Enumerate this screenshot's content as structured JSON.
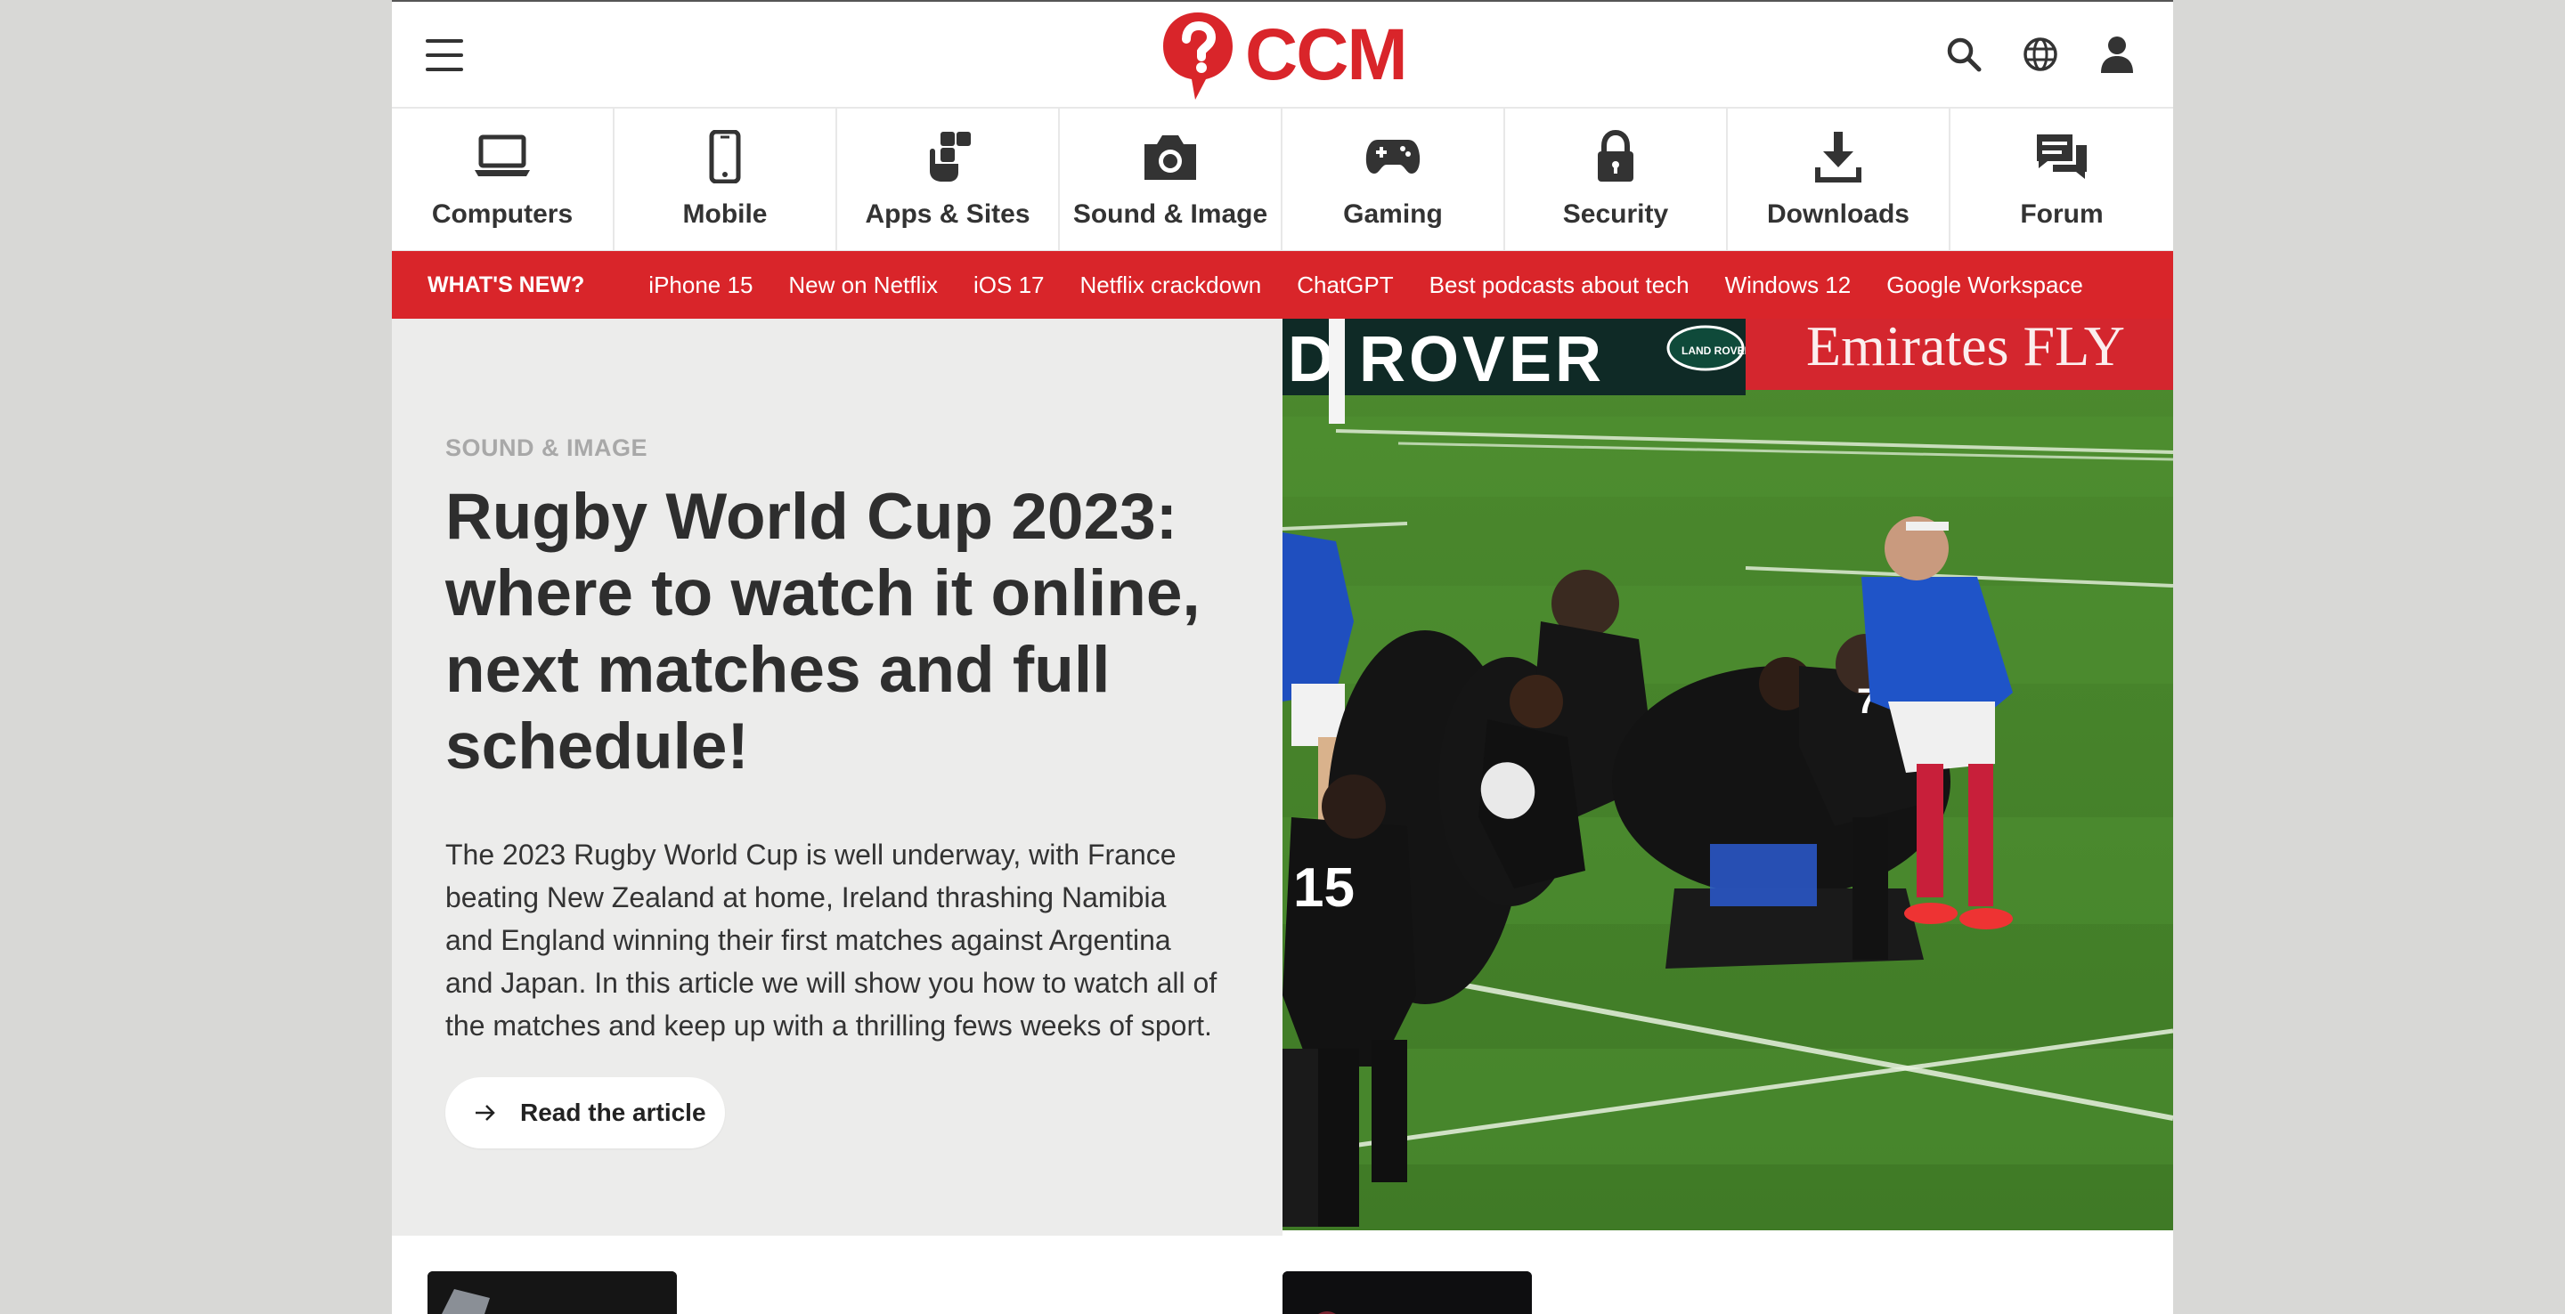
{
  "header": {
    "logo_text": "CCM",
    "brand_color": "#d9252a",
    "icons": [
      "menu-icon",
      "search-icon",
      "globe-icon",
      "user-icon"
    ]
  },
  "categories": [
    {
      "label": "Computers",
      "icon": "laptop-icon"
    },
    {
      "label": "Mobile",
      "icon": "smartphone-icon"
    },
    {
      "label": "Apps & Sites",
      "icon": "touch-apps-icon"
    },
    {
      "label": "Sound & Image",
      "icon": "camera-icon"
    },
    {
      "label": "Gaming",
      "icon": "gamepad-icon"
    },
    {
      "label": "Security",
      "icon": "lock-icon"
    },
    {
      "label": "Downloads",
      "icon": "download-icon"
    },
    {
      "label": "Forum",
      "icon": "chat-icon"
    }
  ],
  "trending": {
    "label": "WHAT'S NEW?",
    "links": [
      "iPhone 15",
      "New on Netflix",
      "iOS 17",
      "Netflix crackdown",
      "ChatGPT",
      "Best podcasts about tech",
      "Windows 12",
      "Google Workspace"
    ]
  },
  "hero": {
    "category": "SOUND & IMAGE",
    "title": "Rugby World Cup 2023: where to watch it online, next matches and full schedule!",
    "description": "The 2023 Rugby World Cup is well underway, with France beating New Zealand at home, Ireland thrashing Namibia and England winning their first matches against Argentina and Japan. In this article we will show you how to watch all of the matches and keep up with a thrilling fews weeks of sport.",
    "read_button": "Read the article",
    "image_board_text_left": "D ROVER",
    "image_board_text_right": "Emirates FLY",
    "image_sponsor_badge": "LAND ROVER",
    "image_jersey_number_left": "15",
    "image_jersey_number_right": "7"
  }
}
